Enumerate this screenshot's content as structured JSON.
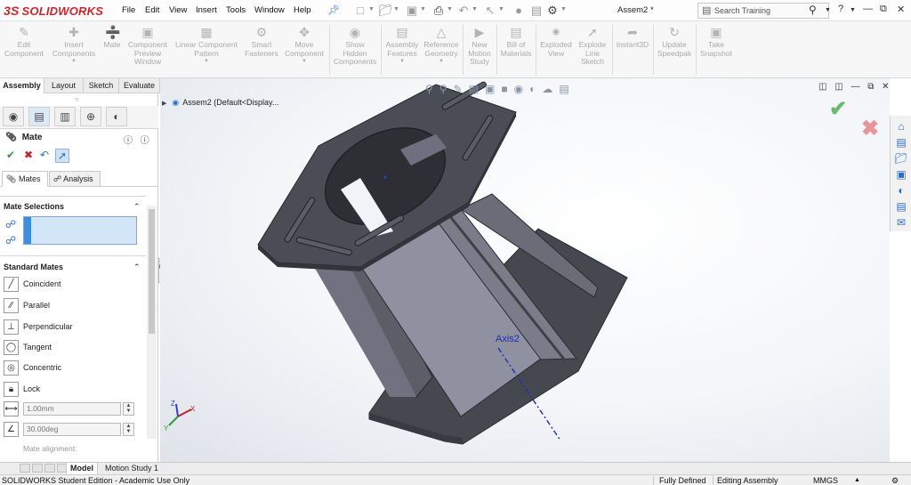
{
  "app": {
    "logo_text": "SOLIDWORKS",
    "logo_mark": "3S",
    "document_title": "Assem2 *",
    "search_placeholder": "Search Training",
    "help_label": "?"
  },
  "menu": [
    "File",
    "Edit",
    "View",
    "Insert",
    "Tools",
    "Window",
    "Help"
  ],
  "ribbon": [
    {
      "label": "Edit\nComponent"
    },
    {
      "label": "Insert\nComponents"
    },
    {
      "label": "Mate"
    },
    {
      "label": "Component\nPreview\nWindow"
    },
    {
      "label": "Linear Component\nPattern"
    },
    {
      "label": "Smart\nFasteners"
    },
    {
      "label": "Move\nComponent"
    },
    {
      "label": "Show\nHidden\nComponents"
    },
    {
      "label": "Assembly\nFeatures"
    },
    {
      "label": "Reference\nGeometry"
    },
    {
      "label": "New\nMotion\nStudy"
    },
    {
      "label": "Bill of\nMaterials"
    },
    {
      "label": "Exploded\nView"
    },
    {
      "label": "Explode\nLine\nSketch"
    },
    {
      "label": "Instant3D"
    },
    {
      "label": "Update\nSpeedpak"
    },
    {
      "label": "Take\nSnapshot"
    }
  ],
  "command_tabs": [
    "Assembly",
    "Layout",
    "Sketch",
    "Evaluate"
  ],
  "property_manager": {
    "title": "Mate",
    "subtabs": [
      "Mates",
      "Analysis"
    ],
    "sections": {
      "mate_selections": "Mate Selections",
      "standard_mates": "Standard Mates"
    },
    "standard_mates": [
      "Coincident",
      "Parallel",
      "Perpendicular",
      "Tangent",
      "Concentric",
      "Lock"
    ],
    "distance_value": "1.00mm",
    "angle_value": "30.00deg",
    "mate_alignment_label": "Mate alignment:"
  },
  "feature_tree": {
    "root": "Assem2  (Default<Display..."
  },
  "viewport": {
    "axis_label": "Axis2",
    "triad": {
      "x": "X",
      "y": "Y",
      "z": "Z"
    }
  },
  "bottom_tabs": [
    "Model",
    "Motion Study 1"
  ],
  "status": {
    "edition": "SOLIDWORKS Student Edition - Academic Use Only",
    "state": "Fully Defined",
    "mode": "Editing Assembly",
    "units": "MMGS"
  },
  "colors": {
    "brand": "#d0242c",
    "accent": "#2b6fc4",
    "part_dark": "#4a4c56",
    "part_face": "#8f91a1"
  }
}
